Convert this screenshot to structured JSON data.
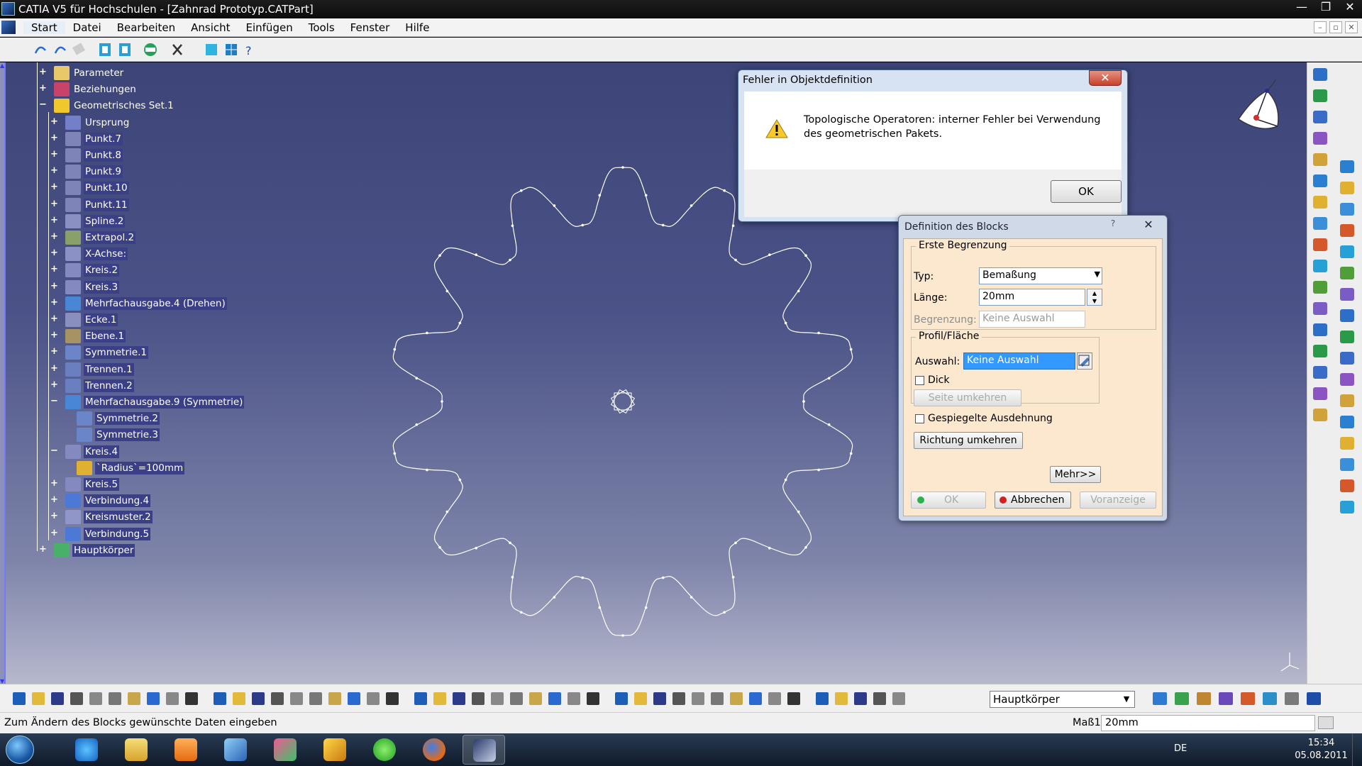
{
  "window": {
    "title": "CATIA V5 für Hochschulen - [Zahnrad Prototyp.CATPart]",
    "controls": [
      "—",
      "❐",
      "✕"
    ]
  },
  "menu": {
    "items": [
      "Start",
      "Datei",
      "Bearbeiten",
      "Ansicht",
      "Einfügen",
      "Tools",
      "Fenster",
      "Hilfe"
    ],
    "mdi_controls": [
      "–",
      "▫",
      "✕"
    ]
  },
  "tree": {
    "nodes": [
      {
        "label": "Parameter",
        "icon": "parameter-icon"
      },
      {
        "label": "Beziehungen",
        "icon": "relations-icon"
      },
      {
        "label": "Geometrisches Set.1",
        "icon": "geometric-set-icon"
      },
      {
        "label": "Ursprung",
        "icon": "origin-icon"
      },
      {
        "label": "Punkt.7",
        "icon": "point-icon"
      },
      {
        "label": "Punkt.8",
        "icon": "point-icon"
      },
      {
        "label": "Punkt.9",
        "icon": "point-icon"
      },
      {
        "label": "Punkt.10",
        "icon": "point-icon"
      },
      {
        "label": "Punkt.11",
        "icon": "point-icon"
      },
      {
        "label": "Spline.2",
        "icon": "spline-icon"
      },
      {
        "label": "Extrapol.2",
        "icon": "extrapol-icon"
      },
      {
        "label": "X-Achse:",
        "icon": "axis-icon"
      },
      {
        "label": "Kreis.2",
        "icon": "circle-icon"
      },
      {
        "label": "Kreis.3",
        "icon": "circle-icon"
      },
      {
        "label": "Mehrfachausgabe.4 (Drehen)",
        "icon": "multi-output-icon"
      },
      {
        "label": "Ecke.1",
        "icon": "corner-icon"
      },
      {
        "label": "Ebene.1",
        "icon": "plane-icon"
      },
      {
        "label": "Symmetrie.1",
        "icon": "symmetry-icon"
      },
      {
        "label": "Trennen.1",
        "icon": "split-icon"
      },
      {
        "label": "Trennen.2",
        "icon": "split-icon"
      },
      {
        "label": "Mehrfachausgabe.9 (Symmetrie)",
        "icon": "multi-output-icon"
      },
      {
        "label": "Symmetrie.2",
        "icon": "symmetry-icon"
      },
      {
        "label": "Symmetrie.3",
        "icon": "symmetry-icon"
      },
      {
        "label": "Kreis.4",
        "icon": "circle-icon"
      },
      {
        "label": "`Radius`=100mm",
        "icon": "formula-icon"
      },
      {
        "label": "Kreis.5",
        "icon": "circle-icon"
      },
      {
        "label": "Verbindung.4",
        "icon": "join-icon"
      },
      {
        "label": "Kreismuster.2",
        "icon": "circular-pattern-icon"
      },
      {
        "label": "Verbindung.5",
        "icon": "join-icon"
      },
      {
        "label": "Hauptkörper",
        "icon": "body-icon"
      }
    ]
  },
  "error_dialog": {
    "title": "Fehler in Objektdefinition",
    "message": "Topologische Operatoren: interner Fehler bei Verwendung des geometrischen Pakets.",
    "ok_label": "OK",
    "close_label": "✕"
  },
  "block_dialog": {
    "title": "Definition des Blocks",
    "help_label": "?",
    "close_label": "✕",
    "first_limit": {
      "legend": "Erste Begrenzung",
      "type_label": "Typ:",
      "type_value": "Bemaßung",
      "length_label": "Länge:",
      "length_value": "20mm",
      "limit_label": "Begrenzung:",
      "limit_value": "Keine Auswahl"
    },
    "profile": {
      "legend": "Profil/Fläche",
      "selection_label": "Auswahl:",
      "selection_value": "Keine Auswahl",
      "thick_label": "Dick",
      "reverse_side_label": "Seite umkehren"
    },
    "mirrored_label": "Gespiegelte Ausdehnung",
    "reverse_direction_label": "Richtung umkehren",
    "more_label": "Mehr>>",
    "ok_label": "OK",
    "cancel_label": "Abbrechen",
    "preview_label": "Voranzeige"
  },
  "bottom_toolbar": {
    "body_select": "Hauptkörper"
  },
  "status": {
    "message": "Zum Ändern des Blocks gewünschte Daten eingeben",
    "measure_label": "Maß1",
    "measure_value": "20mm"
  },
  "taskbar": {
    "language": "DE",
    "time": "15:34",
    "date": "05.08.2011"
  },
  "colors": {
    "viewport_top": "#3d4578",
    "viewport_bottom": "#b6b8cd",
    "dialog_panel": "#fbe8cf",
    "selection": "#3399ff"
  }
}
